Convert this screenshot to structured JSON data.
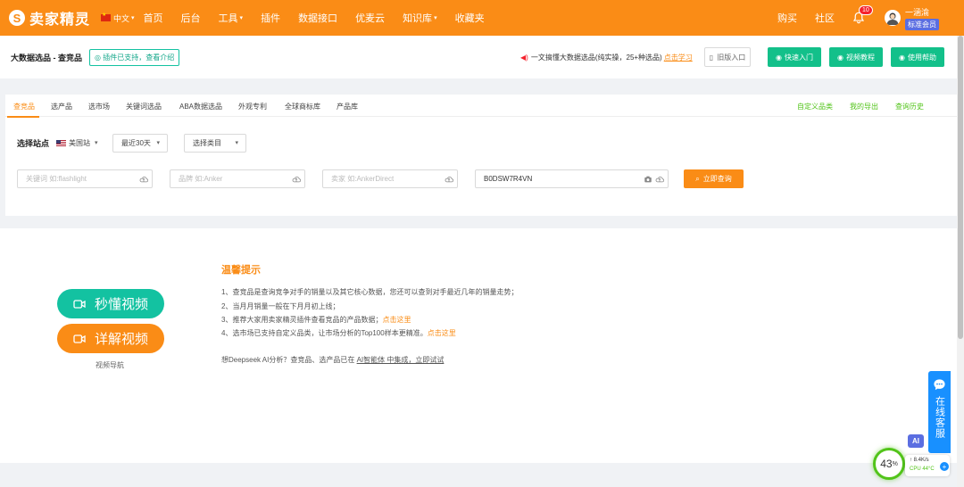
{
  "nav": {
    "logo_mark": "S",
    "logo_text": "卖家精灵",
    "lang": "中文",
    "items": [
      "首页",
      "后台",
      "工具",
      "插件",
      "数据接口",
      "优麦云",
      "知识库",
      "收藏夹"
    ],
    "right_items": [
      "购买",
      "社区"
    ],
    "notification_count": "10",
    "user_name": "一涵渝",
    "member_badge": "标准会员"
  },
  "subbar": {
    "title": "大数据选品 - 查竞品",
    "plugin_tag": "插件已支持，查看介绍",
    "promo_text": "一文搞懂大数据选品(纯实操，25+种选品)",
    "promo_link": "点击学习",
    "old_entry": "旧版入口",
    "quick_start": "快速入门",
    "video_tutorial": "视频教程",
    "help": "使用帮助"
  },
  "tabs": {
    "items": [
      "查竞品",
      "选产品",
      "选市场",
      "关键词选品",
      "ABA数据选品",
      "外观专利",
      "全球商标库",
      "产品库"
    ],
    "right": [
      "自定义品类",
      "我的导出",
      "查询历史"
    ]
  },
  "filters": {
    "site_label": "选择站点",
    "site_value": "美国站",
    "period": "最近30天",
    "category": "选择类目"
  },
  "inputs": {
    "keyword_placeholder": "关键词 如:flashlight",
    "brand_placeholder": "品牌 如:Anker",
    "seller_placeholder": "卖家 如:AnkerDirect",
    "asin_value": "B0DSW7R4VN",
    "query_button": "立即查询"
  },
  "video": {
    "quick": "秒懂视频",
    "detail": "详解视频",
    "nav": "视频导航",
    "quick_color": "#13c2a1",
    "detail_color": "#fa8c16"
  },
  "tips": {
    "title": "温馨提示",
    "line1": "1、查竞品是查询竞争对手的销量以及其它核心数据，您还可以查到对手最近几年的销量走势；",
    "line2": "2、当月月销量一般在下月月初上线；",
    "line3_text": "3、推荐大家用卖家精灵插件查看竞品的产品数据；",
    "line3_link": "点击这里",
    "line4_text": "4、选市场已支持自定义品类，让市场分析的Top100样本更精准。",
    "line4_link": "点击这里",
    "ds_pre": "想Deepseek AI分析？查竞品、选产品已在 ",
    "ds_link": "AI智能体 中集成，立即试试"
  },
  "widgets": {
    "cs_text": "在线客服",
    "ai": "AI",
    "percent": "43",
    "percent_unit": "%",
    "net": "↑ 8.4K/s",
    "cpu": "CPU 44°C",
    "plus": "+"
  },
  "colors": {
    "brand": "#fa8c16",
    "green": "#13c08a",
    "blue": "#1890ff"
  }
}
